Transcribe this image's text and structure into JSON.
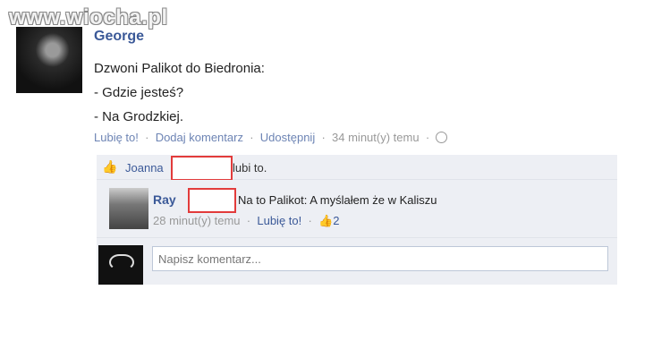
{
  "watermark": "www.wiocha.pl",
  "post": {
    "author": "George",
    "lines": [
      "Dzwoni Palikot do Biedronia:",
      "- Gdzie jesteś?",
      "- Na Grodzkiej."
    ],
    "actions": {
      "like": "Lubię to!",
      "comment": "Dodaj komentarz",
      "share": "Udostępnij",
      "time": "34 minut(y) temu"
    }
  },
  "likes": {
    "name": "Joanna",
    "text": "lubi to."
  },
  "comment": {
    "author": "Ray",
    "text": "Na to Palikot: A myślałem że w Kaliszu",
    "time": "28 minut(y) temu",
    "like": "Lubię to!",
    "like_count": "2"
  },
  "input": {
    "placeholder": "Napisz komentarz..."
  },
  "colors": {
    "link": "#3b5998",
    "redaction_border": "#e23b3b",
    "panel_bg": "#edeff4"
  }
}
